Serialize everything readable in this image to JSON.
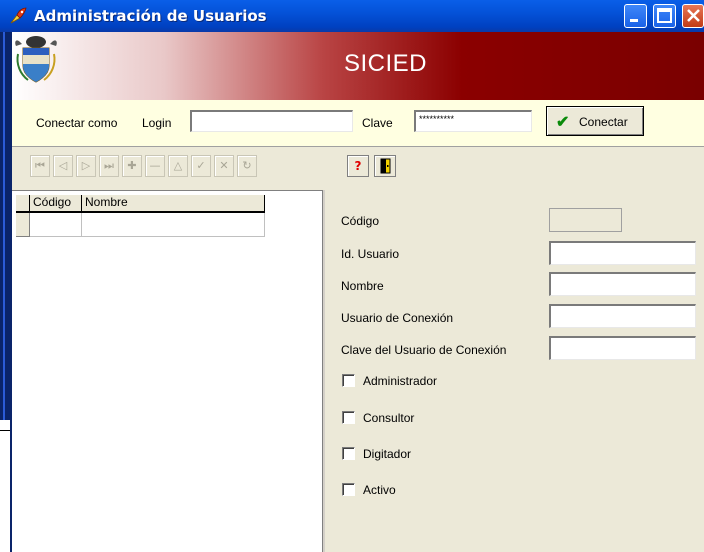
{
  "window": {
    "title": "Administración de Usuarios"
  },
  "banner": {
    "title": "SICIED"
  },
  "login": {
    "connect_as_label": "Conectar como",
    "login_label": "Login",
    "login_value": "",
    "password_label": "Clave",
    "password_value": "**********",
    "connect_button": "Conectar"
  },
  "toolbar": {
    "nav_buttons": [
      "first-record",
      "prior-record",
      "next-record",
      "last-record",
      "insert-record",
      "delete-record",
      "edit-record",
      "post-record",
      "cancel-edit",
      "refresh-data"
    ],
    "help_glyph": "?",
    "icons": {
      "help": "question-icon",
      "exit": "exit-door-icon"
    }
  },
  "grid": {
    "columns": [
      "Código",
      "Nombre"
    ],
    "rows": []
  },
  "form": {
    "fields": [
      {
        "label": "Código",
        "value": ""
      },
      {
        "label": "Id. Usuario",
        "value": ""
      },
      {
        "label": "Nombre",
        "value": ""
      },
      {
        "label": "Usuario de Conexión",
        "value": ""
      },
      {
        "label": "Clave del Usuario de Conexión",
        "value": ""
      }
    ],
    "checkboxes": [
      {
        "label": "Administrador",
        "checked": false
      },
      {
        "label": "Consultor",
        "checked": false
      },
      {
        "label": "Digitador",
        "checked": false
      },
      {
        "label": "Activo",
        "checked": false
      }
    ]
  },
  "colors": {
    "titlebar": "#0452d8",
    "banner_dark": "#7a0000",
    "login_bg": "#ffffe1",
    "face": "#ece9d8"
  }
}
